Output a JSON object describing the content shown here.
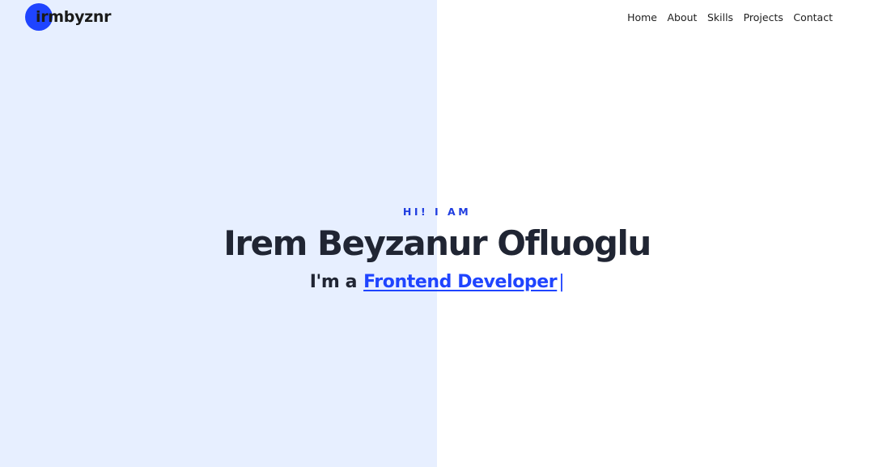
{
  "logo": {
    "initial": "i",
    "text": "rmbyznr"
  },
  "nav": {
    "items": [
      {
        "label": "Home"
      },
      {
        "label": "About"
      },
      {
        "label": "Skills"
      },
      {
        "label": "Projects"
      },
      {
        "label": "Contact"
      }
    ]
  },
  "hero": {
    "greeting": "HI! I AM",
    "name": "Irem Beyzanur Ofluoglu",
    "role_prefix": "I'm a",
    "role": "Frontend Developer",
    "cursor": "|"
  },
  "colors": {
    "accent": "#1f44ff",
    "left_panel": "#e7efff",
    "text_dark": "#202533",
    "background": "#ffffff"
  }
}
